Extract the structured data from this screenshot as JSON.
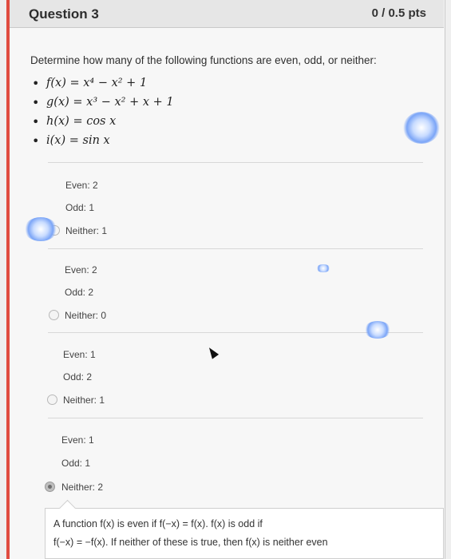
{
  "header": {
    "title": "Question 3",
    "points": "0 / 0.5 pts"
  },
  "question": {
    "prompt": "Determine how many of the following functions are even, odd, or neither:",
    "functions": [
      "f(x) = x⁴ − x² + 1",
      "g(x) = x³ − x² + x + 1",
      "h(x) = cos x",
      "i(x) = sin x"
    ]
  },
  "options": [
    {
      "even": "Even: 2",
      "odd": "Odd: 1",
      "neither": "Neither: 1",
      "selected": false
    },
    {
      "even": "Even: 2",
      "odd": "Odd: 2",
      "neither": "Neither: 0",
      "selected": false
    },
    {
      "even": "Even: 1",
      "odd": "Odd: 2",
      "neither": "Neither: 1",
      "selected": false
    },
    {
      "even": "Even: 1",
      "odd": "Odd: 1",
      "neither": "Neither: 2",
      "selected": true
    }
  ],
  "feedback": {
    "line1": "A function f(x) is even if f(−x) = f(x). f(x) is odd if",
    "line2": "f(−x) = −f(x). If neither of these is true, then f(x) is neither even"
  },
  "colors": {
    "accent": "#e04c40",
    "selected_radio": "#bfbfbf"
  },
  "icons": [
    "cursor-arrow-icon"
  ]
}
